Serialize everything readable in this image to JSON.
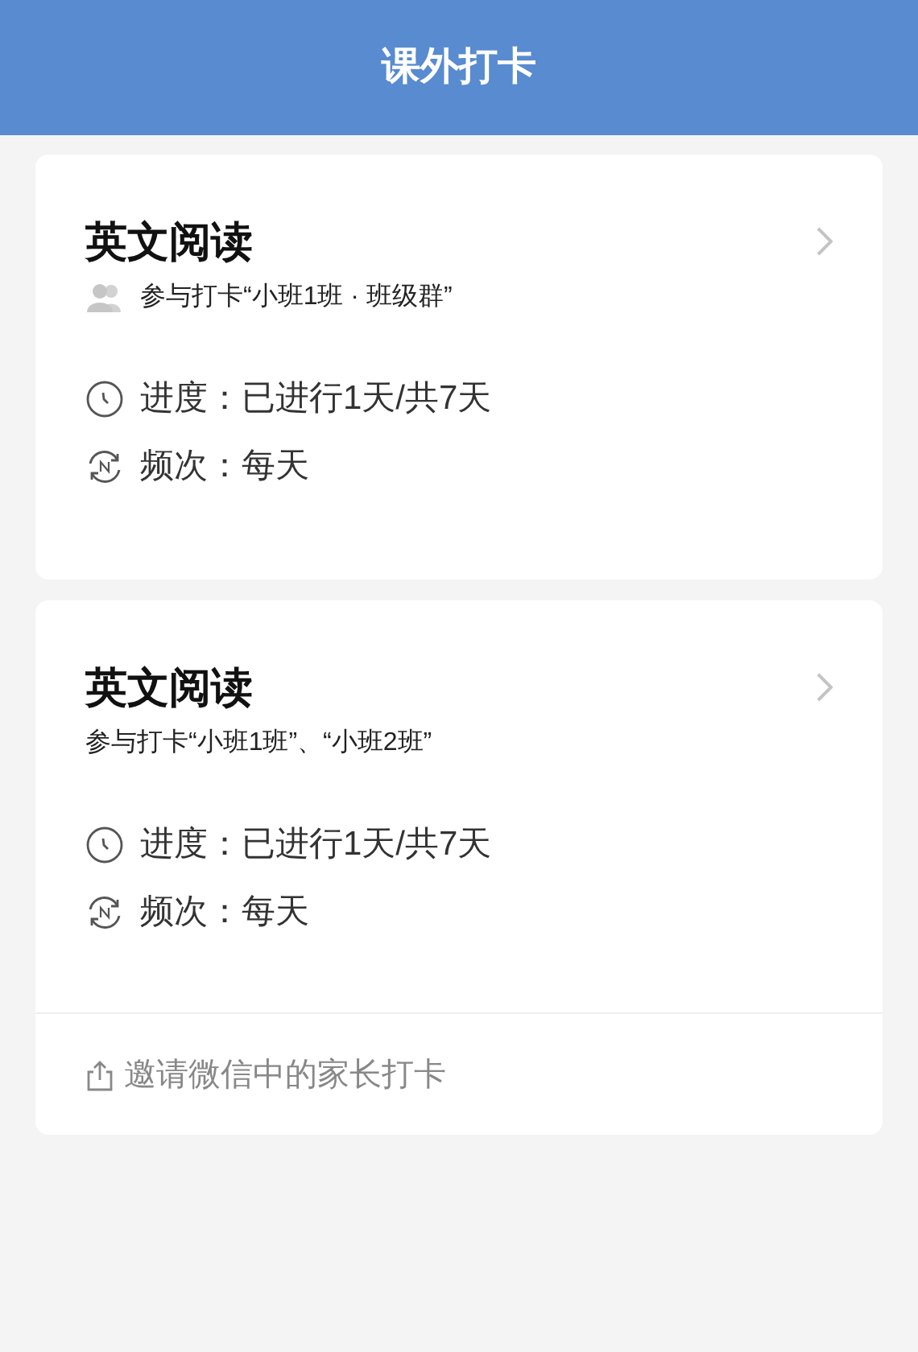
{
  "header": {
    "title": "课外打卡"
  },
  "cards": [
    {
      "title": "英文阅读",
      "participants": {
        "kind": "group",
        "text": "参与打卡“小班1班 · 班级群”"
      },
      "progress": {
        "label": "进度：",
        "value": "已进行1天/共7天"
      },
      "frequency": {
        "label": "频次：",
        "value": "每天"
      }
    },
    {
      "title": "英文阅读",
      "participants": {
        "kind": "classes",
        "text": "参与打卡“小班1班”、“小班2班”"
      },
      "progress": {
        "label": "进度：",
        "value": "已进行1天/共7天"
      },
      "frequency": {
        "label": "频次：",
        "value": "每天"
      },
      "invite": "邀请微信中的家长打卡"
    }
  ]
}
